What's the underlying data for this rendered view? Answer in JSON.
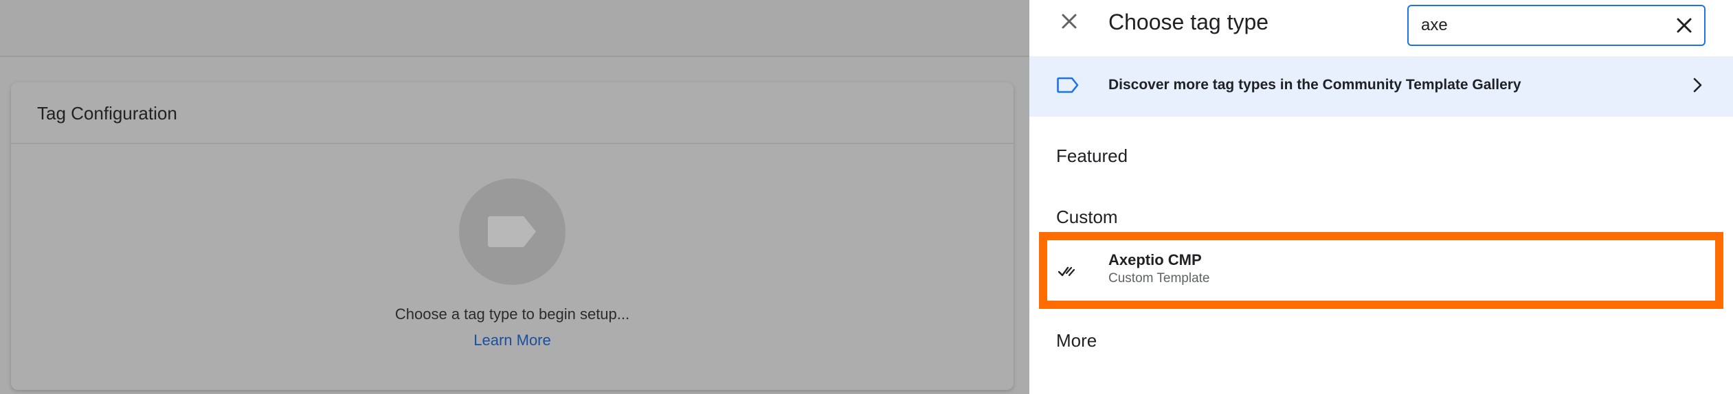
{
  "left_panel": {
    "card_title": "Tag Configuration",
    "setup_hint": "Choose a tag type to begin setup...",
    "learn_more": "Learn More"
  },
  "drawer": {
    "title": "Choose tag type",
    "search": {
      "value": "axe"
    },
    "community_banner": "Discover more tag types in the Community Template Gallery",
    "sections": {
      "featured": "Featured",
      "custom": "Custom",
      "more": "More"
    },
    "result": {
      "title": "Axeptio CMP",
      "subtitle": "Custom Template"
    }
  },
  "colors": {
    "accent_blue": "#1a73e8",
    "highlight_orange": "#ff6d00",
    "banner_bg": "#e8f0fe",
    "overlay_gray": "#ababab"
  },
  "icons": {
    "close": "close-icon",
    "clear": "clear-search-icon",
    "community": "tag-outline-icon",
    "chevron": "chevron-right-icon",
    "result": "axeptio-check-icon",
    "placeholder": "tag-icon"
  }
}
